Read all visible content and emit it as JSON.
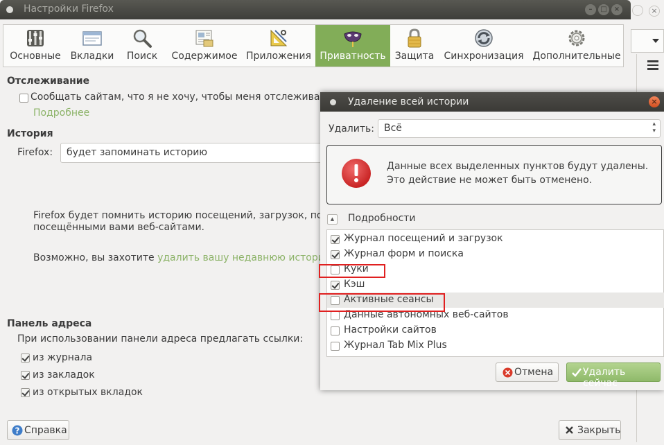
{
  "main_window": {
    "title": "Настройки Firefox"
  },
  "toolbar": {
    "tabs": [
      {
        "label": "Основные",
        "icon": "switches-icon"
      },
      {
        "label": "Вкладки",
        "icon": "tabs-icon"
      },
      {
        "label": "Поиск",
        "icon": "magnifier-icon"
      },
      {
        "label": "Содержимое",
        "icon": "content-icon"
      },
      {
        "label": "Приложения",
        "icon": "applications-icon"
      },
      {
        "label": "Приватность",
        "icon": "mask-icon",
        "active": true
      },
      {
        "label": "Защита",
        "icon": "padlock-icon"
      },
      {
        "label": "Синхронизация",
        "icon": "sync-icon"
      },
      {
        "label": "Дополнительные",
        "icon": "gear-icon"
      }
    ]
  },
  "tracking": {
    "title": "Отслеживание",
    "checkbox_label": "Сообщать сайтам, что я не хочу, чтобы меня отслеживали",
    "checked": false,
    "more_link": "Подробнее"
  },
  "history": {
    "title": "История",
    "firefox_label": "Firefox:",
    "mode_value": "будет запоминать историю",
    "desc_line1": "Firefox будет помнить историю посещений, загрузок, поиск",
    "desc_line2": "посещёнными вами веб-сайтами.",
    "maybe_prefix": "Возможно, вы захотите ",
    "maybe_link": "удалить вашу недавнюю историю"
  },
  "address_bar": {
    "title": "Панель адреса",
    "subtitle": "При использовании панели адреса предлагать ссылки:",
    "options": [
      {
        "label": "из журнала",
        "checked": true
      },
      {
        "label": "из закладок",
        "checked": true
      },
      {
        "label": "из открытых вкладок",
        "checked": true
      }
    ]
  },
  "footer": {
    "help_label": "Справка",
    "close_label": "Закрыть"
  },
  "dialog": {
    "title": "Удаление всей истории",
    "range_label": "Удалить:",
    "range_value": "Всё",
    "warning_line1": "Данные всех выделенных пунктов будут удалены.",
    "warning_line2": "Это действие не может быть отменено.",
    "details_label": "Подробности",
    "items": [
      {
        "label": "Журнал посещений и загрузок",
        "checked": true
      },
      {
        "label": "Журнал форм и поиска",
        "checked": true
      },
      {
        "label": "Куки",
        "checked": false
      },
      {
        "label": "Кэш",
        "checked": true
      },
      {
        "label": "Активные сеансы",
        "checked": false
      },
      {
        "label": "Данные автономных веб-сайтов",
        "checked": false
      },
      {
        "label": "Настройки сайтов",
        "checked": false
      },
      {
        "label": "Журнал Tab Mix Plus",
        "checked": false
      }
    ],
    "cancel_label": "Отмена",
    "clear_label": "Удалить сейчас"
  },
  "colors": {
    "accent_green": "#82ad58",
    "link_green": "#8cb368",
    "highlight_red": "#e02020"
  }
}
